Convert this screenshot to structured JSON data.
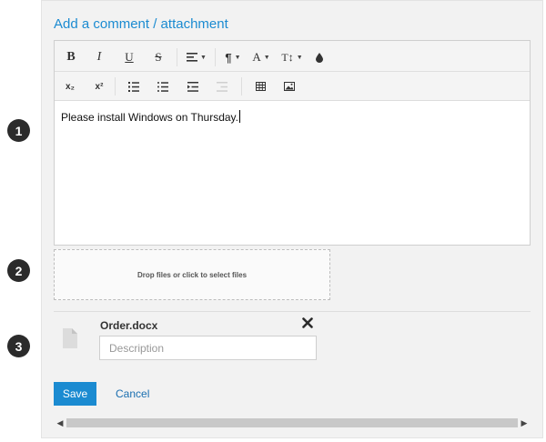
{
  "steps": [
    "1",
    "2",
    "3"
  ],
  "panel": {
    "title": "Add a comment / attachment"
  },
  "toolbar": {
    "bold": "B",
    "italic": "I",
    "underline": "U",
    "strikethrough": "S",
    "paragraph": "¶",
    "font_color": "A",
    "font_size": "T↕",
    "subscript": "x₂",
    "superscript": "x²"
  },
  "editor": {
    "text": "Please install Windows on Thursday."
  },
  "dropzone": {
    "text": "Drop files or click to select files"
  },
  "attachment": {
    "file_name": "Order.docx",
    "description_placeholder": "Description",
    "description_value": ""
  },
  "actions": {
    "save_label": "Save",
    "cancel_label": "Cancel"
  },
  "colors": {
    "accent": "#1b8bd1",
    "badge": "#2b2b2b"
  }
}
